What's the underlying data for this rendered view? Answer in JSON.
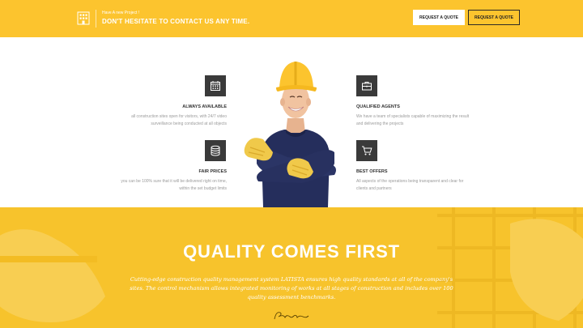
{
  "topbar": {
    "kicker": "Have A new Project !",
    "cta": "DON'T HESITATE TO CONTACT US ANY TIME.",
    "btn_primary": "REQUEST A QUOTE",
    "btn_secondary": "REQUEST A QUOTE",
    "accent": "#fcc42e"
  },
  "features": [
    {
      "icon": "calendar-icon",
      "title": "ALWAYS AVAILABLE",
      "desc": "all construction sites open for visitors, with 24/7 video surveillance being conducted at all objects"
    },
    {
      "icon": "briefcase-icon",
      "title": "QUALIFIED AGENTS",
      "desc": "We have a team of specialists capable of maximizing the result and delivering the projects"
    },
    {
      "icon": "coins-icon",
      "title": "FAIR PRICES",
      "desc": "you can be 100% sure that it will be delivered right on time, within the set budget limits"
    },
    {
      "icon": "cart-icon",
      "title": "BEST OFFERS",
      "desc": "All aspects of the operations being transparent and clear for clients and partners"
    }
  ],
  "band": {
    "headline": "QUALITY COMES FIRST",
    "body": "Cutting-edge construction quality management system LATISTA ensures high quality standards at all of the company's sites. The control mechanism allows integrated monitoring of works at all stages of construction and includes over 100 quality assessment benchmarks.",
    "accent": "#f7c32c"
  }
}
